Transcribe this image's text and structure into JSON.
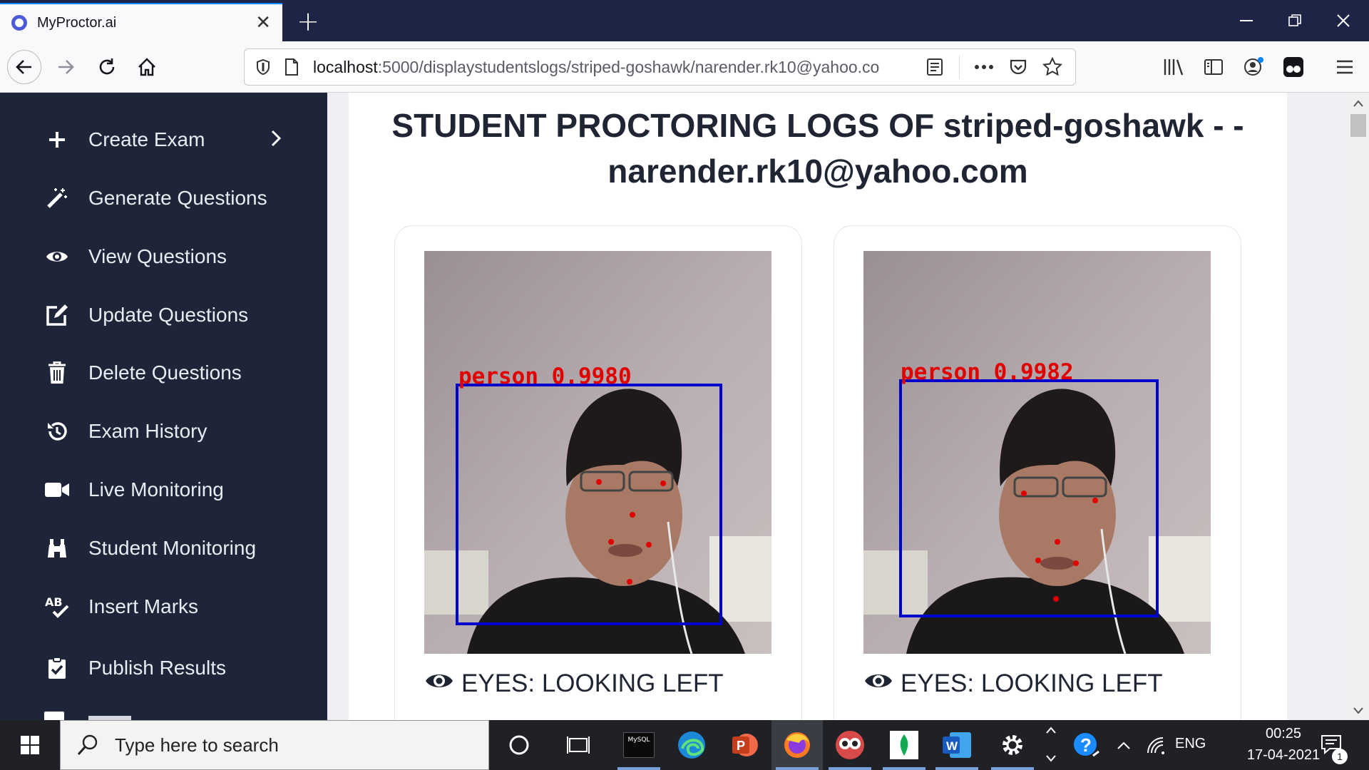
{
  "browser": {
    "tab_title": "MyProctor.ai",
    "url_host": "localhost",
    "url_rest": ":5000/displaystudentslogs/striped-goshawk/narender.rk10@yahoo.co"
  },
  "sidebar": {
    "items": [
      {
        "label": "Create Exam",
        "icon": "plus-icon"
      },
      {
        "label": "Generate Questions",
        "icon": "magic-wand-icon"
      },
      {
        "label": "View Questions",
        "icon": "eye-icon"
      },
      {
        "label": "Update Questions",
        "icon": "edit-icon"
      },
      {
        "label": "Delete Questions",
        "icon": "trash-icon"
      },
      {
        "label": "Exam History",
        "icon": "history-icon"
      },
      {
        "label": "Live Monitoring",
        "icon": "video-camera-icon"
      },
      {
        "label": "Student Monitoring",
        "icon": "binoculars-icon"
      },
      {
        "label": "Insert Marks",
        "icon": "spell-check-icon"
      },
      {
        "label": "Publish Results",
        "icon": "clipboard-check-icon"
      }
    ]
  },
  "main": {
    "title_line1": "STUDENT PROCTORING LOGS OF striped-goshawk - -",
    "title_line2": "narender.rk10@yahoo.com",
    "cards": [
      {
        "detection_label": "person  0.9980",
        "caption": "EYES: LOOKING LEFT"
      },
      {
        "detection_label": "person  0.9982",
        "caption": "EYES: LOOKING LEFT"
      }
    ]
  },
  "taskbar": {
    "search_placeholder": "Type here to search",
    "language": "ENG",
    "time": "00:25",
    "date": "17-04-2021",
    "notification_count": "1",
    "mysql_label": "MySQL"
  },
  "colors": {
    "sidebar_bg": "#1e2538",
    "tabbar_bg": "#1e2446",
    "detection_box": "#0000cc",
    "detection_text": "#e00000"
  }
}
